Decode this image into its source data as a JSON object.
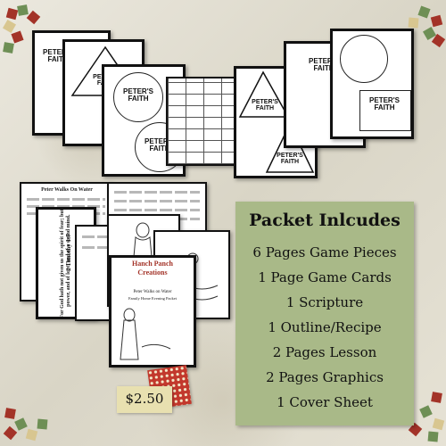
{
  "packet": {
    "title": "Packet Inlcudes",
    "items": [
      "6 Pages Game Pieces",
      "1 Page Game Cards",
      "1 Scripture",
      "1 Outline/Recipe",
      "2 Pages Lesson",
      "2 Pages Graphics",
      "1 Cover Sheet"
    ]
  },
  "price": "$2.50",
  "game_label": "PETER'S FAITH",
  "cover": {
    "brand_line1": "Hanch Panch",
    "brand_line2": "Creations",
    "subtitle": "Peter Walks on Water",
    "subtitle2": "Family Home Evening Packet"
  },
  "lesson": {
    "heading": "Peter Walks On Water",
    "scripture_ref": "2 Timothy 1:7",
    "scripture_quote": "For God hath not given us the spirit of fear; but of power, and of love, and of a sound mind."
  },
  "colors": {
    "background": "#e4e1d6",
    "packet_panel": "#a9b988",
    "accent_red": "#a33328",
    "accent_green": "#6e8f55"
  }
}
